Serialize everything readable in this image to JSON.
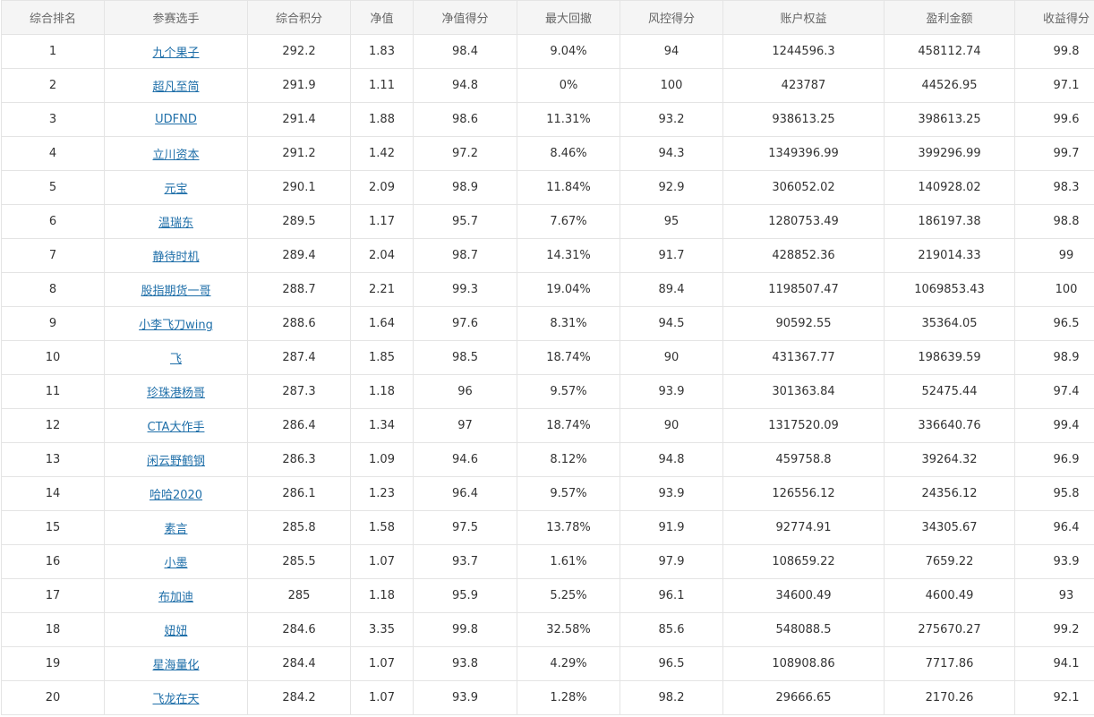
{
  "table": {
    "headers": [
      "综合排名",
      "参赛选手",
      "综合积分",
      "净值",
      "净值得分",
      "最大回撤",
      "风控得分",
      "账户权益",
      "盈利金额",
      "收益得分"
    ],
    "rows": [
      [
        "1",
        "九个果子",
        "292.2",
        "1.83",
        "98.4",
        "9.04%",
        "94",
        "1244596.3",
        "458112.74",
        "99.8"
      ],
      [
        "2",
        "超凡至简",
        "291.9",
        "1.11",
        "94.8",
        "0%",
        "100",
        "423787",
        "44526.95",
        "97.1"
      ],
      [
        "3",
        "UDFND",
        "291.4",
        "1.88",
        "98.6",
        "11.31%",
        "93.2",
        "938613.25",
        "398613.25",
        "99.6"
      ],
      [
        "4",
        "立川资本",
        "291.2",
        "1.42",
        "97.2",
        "8.46%",
        "94.3",
        "1349396.99",
        "399296.99",
        "99.7"
      ],
      [
        "5",
        "元宝",
        "290.1",
        "2.09",
        "98.9",
        "11.84%",
        "92.9",
        "306052.02",
        "140928.02",
        "98.3"
      ],
      [
        "6",
        "温瑞东",
        "289.5",
        "1.17",
        "95.7",
        "7.67%",
        "95",
        "1280753.49",
        "186197.38",
        "98.8"
      ],
      [
        "7",
        "静待时机",
        "289.4",
        "2.04",
        "98.7",
        "14.31%",
        "91.7",
        "428852.36",
        "219014.33",
        "99"
      ],
      [
        "8",
        "股指期货一哥",
        "288.7",
        "2.21",
        "99.3",
        "19.04%",
        "89.4",
        "1198507.47",
        "1069853.43",
        "100"
      ],
      [
        "9",
        "小李飞刀wing",
        "288.6",
        "1.64",
        "97.6",
        "8.31%",
        "94.5",
        "90592.55",
        "35364.05",
        "96.5"
      ],
      [
        "10",
        "飞",
        "287.4",
        "1.85",
        "98.5",
        "18.74%",
        "90",
        "431367.77",
        "198639.59",
        "98.9"
      ],
      [
        "11",
        "珍珠港杨哥",
        "287.3",
        "1.18",
        "96",
        "9.57%",
        "93.9",
        "301363.84",
        "52475.44",
        "97.4"
      ],
      [
        "12",
        "CTA大作手",
        "286.4",
        "1.34",
        "97",
        "18.74%",
        "90",
        "1317520.09",
        "336640.76",
        "99.4"
      ],
      [
        "13",
        "闲云野鹤钢",
        "286.3",
        "1.09",
        "94.6",
        "8.12%",
        "94.8",
        "459758.8",
        "39264.32",
        "96.9"
      ],
      [
        "14",
        "哈哈2020",
        "286.1",
        "1.23",
        "96.4",
        "9.57%",
        "93.9",
        "126556.12",
        "24356.12",
        "95.8"
      ],
      [
        "15",
        "素言",
        "285.8",
        "1.58",
        "97.5",
        "13.78%",
        "91.9",
        "92774.91",
        "34305.67",
        "96.4"
      ],
      [
        "16",
        "小墨",
        "285.5",
        "1.07",
        "93.7",
        "1.61%",
        "97.9",
        "108659.22",
        "7659.22",
        "93.9"
      ],
      [
        "17",
        "布加迪",
        "285",
        "1.18",
        "95.9",
        "5.25%",
        "96.1",
        "34600.49",
        "4600.49",
        "93"
      ],
      [
        "18",
        "妞妞",
        "284.6",
        "3.35",
        "99.8",
        "32.58%",
        "85.6",
        "548088.5",
        "275670.27",
        "99.2"
      ],
      [
        "19",
        "星海量化",
        "284.4",
        "1.07",
        "93.8",
        "4.29%",
        "96.5",
        "108908.86",
        "7717.86",
        "94.1"
      ],
      [
        "20",
        "飞龙在天",
        "284.2",
        "1.07",
        "93.9",
        "1.28%",
        "98.2",
        "29666.65",
        "2170.26",
        "92.1"
      ]
    ]
  }
}
